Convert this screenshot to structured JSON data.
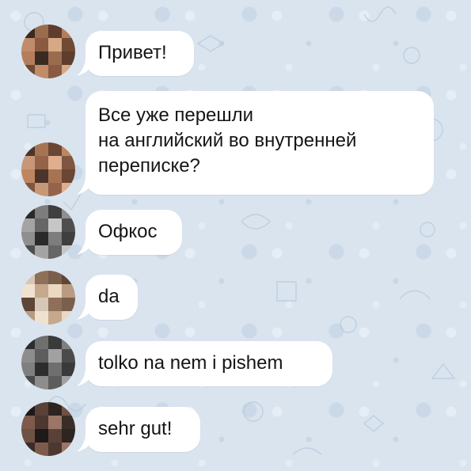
{
  "chat": {
    "messages": [
      {
        "text_lines": [
          "Привет!"
        ],
        "avatar_colors": [
          "#3a2a22",
          "#6f4a35",
          "#9a6c4e",
          "#c08c69",
          "#5e3d2d",
          "#8a5b42",
          "#b57d5c",
          "#d6a884"
        ]
      },
      {
        "text_lines": [
          "Все уже перешли",
          "на английский во внутренней",
          "переписке?"
        ],
        "avatar_colors": [
          "#4b3429",
          "#7f563f",
          "#a77453",
          "#c79877",
          "#6a4634",
          "#94634a",
          "#bd8661",
          "#dfae8e"
        ]
      },
      {
        "text_lines": [
          "Офкос"
        ],
        "avatar_colors": [
          "#2a2a2a",
          "#4e4e4e",
          "#7d7d7d",
          "#a4a4a4",
          "#3f3f3f",
          "#666666",
          "#8f8f8f",
          "#c6c6c6"
        ]
      },
      {
        "text_lines": [
          "da"
        ],
        "avatar_colors": [
          "#d7c7b7",
          "#b89b81",
          "#8e6f59",
          "#f0e1d1",
          "#7b5f4d",
          "#c5a98d",
          "#5e4537",
          "#ead8c2"
        ]
      },
      {
        "text_lines": [
          "tolko na nem i pishem"
        ],
        "avatar_colors": [
          "#2d2d2d",
          "#4b4b4b",
          "#6f6f6f",
          "#8d8d8d",
          "#3a3a3a",
          "#5d5d5d",
          "#7f7f7f",
          "#a1a1a1"
        ]
      },
      {
        "text_lines": [
          "sehr gut!"
        ],
        "avatar_colors": [
          "#1e1a18",
          "#3a2d28",
          "#5a4138",
          "#7e5a4c",
          "#2e2420",
          "#4d3830",
          "#6f5144",
          "#9b7566"
        ]
      }
    ]
  }
}
